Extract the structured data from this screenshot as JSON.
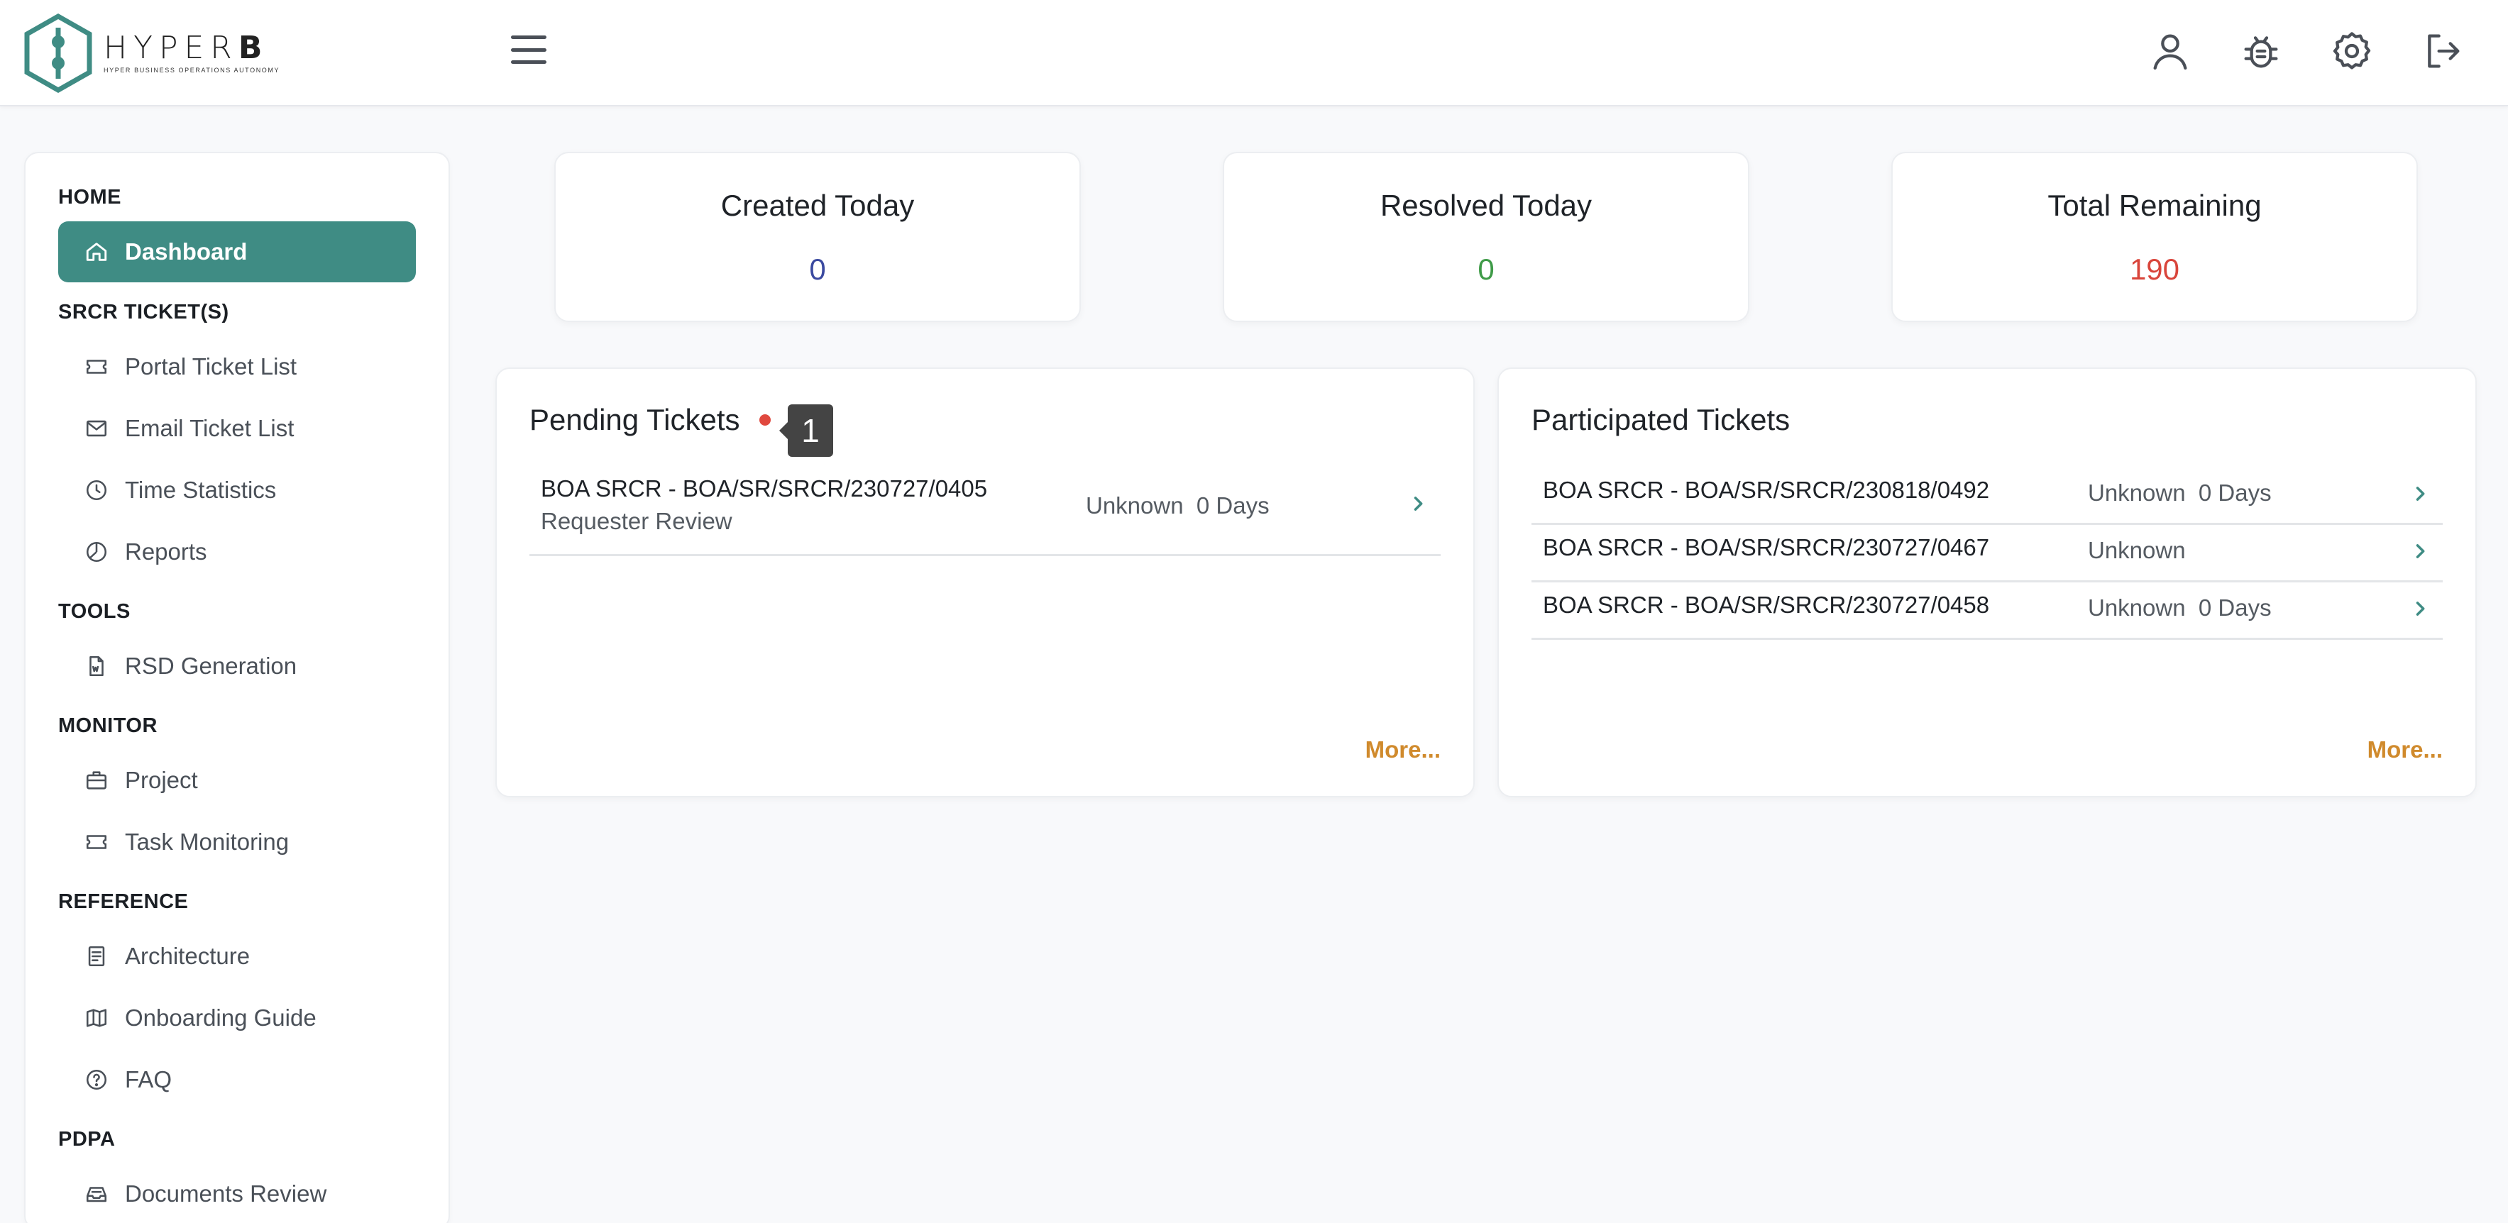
{
  "brand": {
    "name_light": "HYPER",
    "name_bold": "B",
    "tagline": "HYPER BUSINESS OPERATIONS AUTONOMY",
    "accent": "#3f8c84"
  },
  "header": {
    "menu_icon": "hamburger-icon",
    "icons": [
      "user-icon",
      "bug-icon",
      "gear-icon",
      "logout-icon"
    ]
  },
  "sidebar": {
    "sections": [
      {
        "title": "HOME",
        "items": [
          {
            "label": "Dashboard",
            "icon": "home-icon",
            "active": true
          }
        ]
      },
      {
        "title": "SRCR TICKET(S)",
        "items": [
          {
            "label": "Portal Ticket List",
            "icon": "ticket-icon"
          },
          {
            "label": "Email Ticket List",
            "icon": "mail-icon"
          },
          {
            "label": "Time Statistics",
            "icon": "clock-icon"
          },
          {
            "label": "Reports",
            "icon": "pie-chart-icon"
          }
        ]
      },
      {
        "title": "TOOLS",
        "items": [
          {
            "label": "RSD Generation",
            "icon": "word-doc-icon"
          }
        ]
      },
      {
        "title": "MONITOR",
        "items": [
          {
            "label": "Project",
            "icon": "briefcase-icon"
          },
          {
            "label": "Task Monitoring",
            "icon": "ticket-icon"
          }
        ]
      },
      {
        "title": "REFERENCE",
        "items": [
          {
            "label": "Architecture",
            "icon": "document-icon"
          },
          {
            "label": "Onboarding Guide",
            "icon": "map-icon"
          },
          {
            "label": "FAQ",
            "icon": "help-circle-icon"
          }
        ]
      },
      {
        "title": "PDPA",
        "items": [
          {
            "label": "Documents Review",
            "icon": "inbox-icon"
          }
        ]
      }
    ]
  },
  "stats": [
    {
      "title": "Created Today",
      "value": "0",
      "color": "#3b4aa0"
    },
    {
      "title": "Resolved Today",
      "value": "0",
      "color": "#3f9b48"
    },
    {
      "title": "Total Remaining",
      "value": "190",
      "color": "#d9453b"
    }
  ],
  "pending": {
    "title": "Pending Tickets",
    "badge": "1",
    "rows": [
      {
        "code": "BOA SRCR - BOA/SR/SRCR/230727/0405",
        "sub": "Requester Review",
        "status": "Unknown  0 Days"
      }
    ],
    "more": "More..."
  },
  "participated": {
    "title": "Participated Tickets",
    "rows": [
      {
        "code": "BOA SRCR - BOA/SR/SRCR/230818/0492",
        "status": "Unknown  0 Days"
      },
      {
        "code": "BOA SRCR - BOA/SR/SRCR/230727/0467",
        "status": "Unknown"
      },
      {
        "code": "BOA SRCR - BOA/SR/SRCR/230727/0458",
        "status": "Unknown  0 Days"
      }
    ],
    "more": "More..."
  }
}
